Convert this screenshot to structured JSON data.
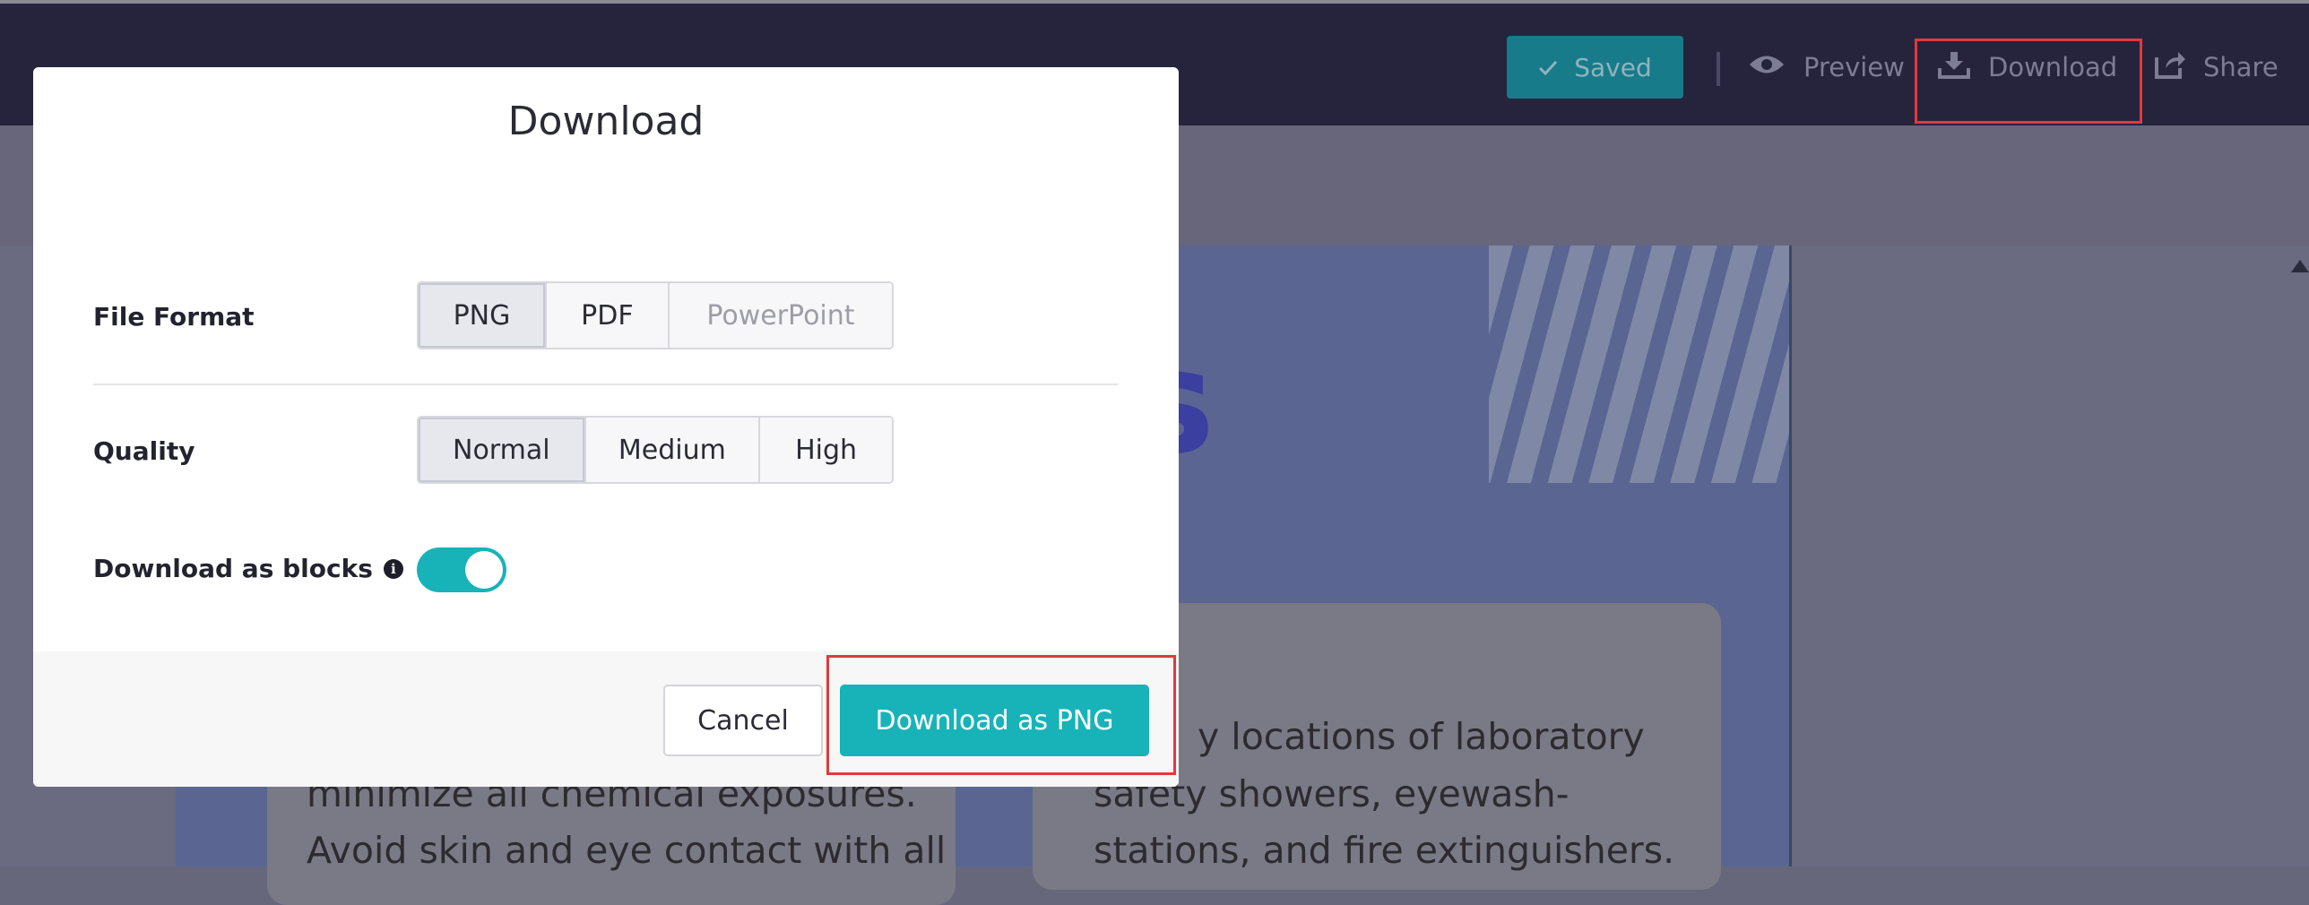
{
  "topbar": {
    "saved_label": "Saved",
    "preview_label": "Preview",
    "download_label": "Download",
    "share_label": "Share"
  },
  "background": {
    "ghost_letter": "s",
    "right_card_lines": [
      "y locations of laboratory",
      "safety showers, eyewash-",
      "stations, and fire extinguishers."
    ],
    "left_card_lines": [
      "minimize all chemical exposures.",
      "Avoid skin and eye contact with all"
    ]
  },
  "modal": {
    "title": "Download",
    "file_format": {
      "label": "File Format",
      "options": [
        "PNG",
        "PDF",
        "PowerPoint"
      ],
      "selected": "PNG"
    },
    "quality": {
      "label": "Quality",
      "options": [
        "Normal",
        "Medium",
        "High"
      ],
      "selected": "Normal"
    },
    "download_as_blocks": {
      "label": "Download as blocks",
      "enabled": true
    },
    "cancel_label": "Cancel",
    "download_button_label": "Download as PNG"
  },
  "colors": {
    "accent": "#17b3b9",
    "topbar_bg": "#26243d",
    "highlight": "#e03a3a"
  }
}
